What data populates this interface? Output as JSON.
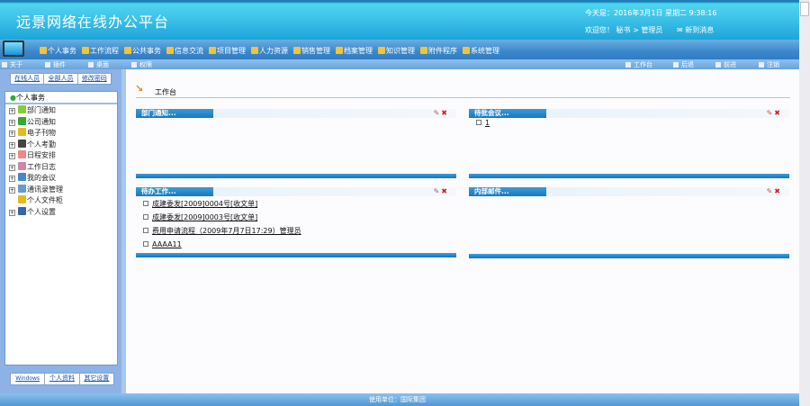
{
  "header": {
    "title": "远景网络在线办公平台",
    "date": "今天是：2016年3月1日 星期二 9:38:16",
    "welcome": "欢迎您！ 秘书 > 管理员",
    "message": "消息",
    "message_label": "新到消息"
  },
  "menu": [
    "个人事务",
    "工作流程",
    "公共事务",
    "信息交流",
    "项目管理",
    "人力资源",
    "销售管理",
    "档案管理",
    "知识管理",
    "附件程序",
    "系统管理"
  ],
  "subtoolbar": {
    "left": [
      "关于",
      "插件",
      "桌面",
      "权限"
    ],
    "right": [
      "工作台",
      "后退",
      "前进",
      "注销"
    ]
  },
  "sidebar": {
    "top_links": [
      "在线人员",
      "全部人员",
      "修改密码"
    ],
    "tree_title": "个人事务",
    "tree": [
      "部门通知",
      "公司通知",
      "电子刊物",
      "个人考勤",
      "日程安排",
      "工作日志",
      "我的会议",
      "通讯录管理",
      "个人文件柜",
      "个人设置"
    ],
    "bottom_links": [
      "Windows",
      "个人资料",
      "其它设置"
    ]
  },
  "main": {
    "breadcrumb": "工作台",
    "panels": [
      {
        "title": "部门通知...",
        "items": []
      },
      {
        "title": "待批会议...",
        "items": [
          "1"
        ]
      },
      {
        "title": "待办工作...",
        "items": [
          "成建委发[2009]0004号[收文单]",
          "成建委发[2009]0003号[收文单]",
          "费用申请流程（2009年7月7日17:29）管理员",
          "AAAA11"
        ]
      },
      {
        "title": "内部邮件...",
        "items": []
      }
    ]
  },
  "footer": {
    "text": "使用单位：国际集团"
  }
}
